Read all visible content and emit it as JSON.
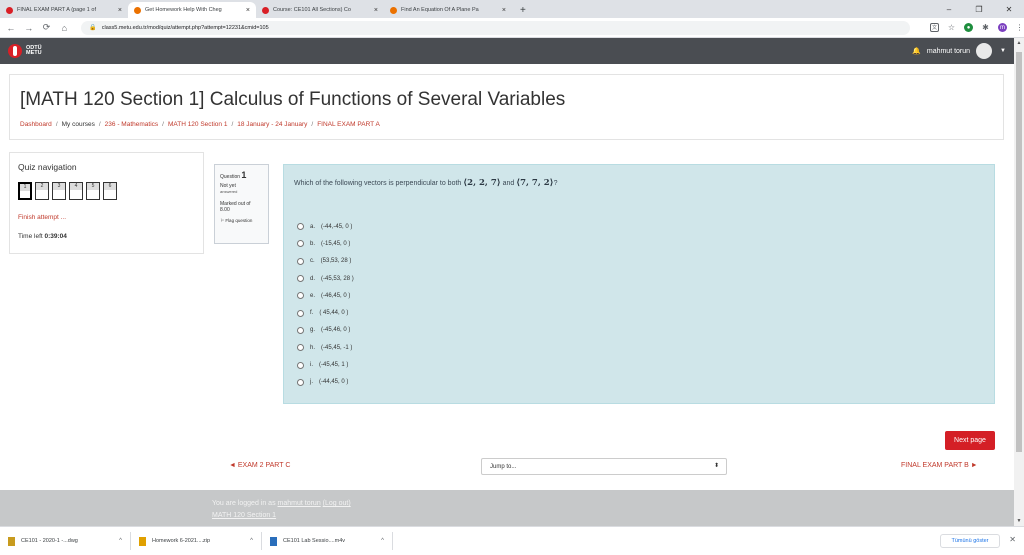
{
  "browser": {
    "tabs": [
      {
        "title": "FINAL EXAM PART A (page 1 of",
        "color": "#d91f26",
        "active": false
      },
      {
        "title": "Get Homework Help With Cheg",
        "color": "#eb7100",
        "active": true
      },
      {
        "title": "Course: CE101 All Sections) Co",
        "color": "#d91f26",
        "active": false
      },
      {
        "title": "Find An Equation Of A Plane Pa",
        "color": "#eb7100",
        "active": false
      }
    ],
    "tab_close": "×",
    "new_tab": "+",
    "window": {
      "minimize": "–",
      "maximize": "❐",
      "close": "✕"
    },
    "url": "class5.metu.edu.tr/mod/quiz/attempt.php?attempt=12231&cmid=105",
    "extensions": {
      "profile_initial": "m"
    }
  },
  "header": {
    "logo_text_line1": "ODTÜ",
    "logo_text_line2": "METU",
    "user_name": "mahmut torun"
  },
  "page": {
    "title": "[MATH 120 Section 1] Calculus of Functions of Several Variables",
    "breadcrumb": [
      "Dashboard",
      "My courses",
      "236 - Mathematics",
      "MATH 120 Section 1",
      "18 January - 24 January",
      "FINAL EXAM PART A"
    ]
  },
  "quiz_nav": {
    "title": "Quiz navigation",
    "buttons": [
      "1",
      "2",
      "3",
      "4",
      "5",
      "6"
    ],
    "finish": "Finish attempt ...",
    "time_label": "Time left",
    "time_value": "0:39:04"
  },
  "question": {
    "label": "Question",
    "number": "1",
    "state_line1": "Not yet",
    "state_line2": "answered",
    "grade_line1": "Marked out of",
    "grade_line2": "8.00",
    "flag": "Flag question",
    "text_before": "Which of the following vectors is perpendicular to both",
    "vec1": "⟨2, 2, 7⟩",
    "text_and": "and",
    "vec2": "⟨7, 7, 2⟩",
    "text_after": "?",
    "answers": [
      {
        "letter": "a.",
        "value": "(-44,-45, 0 )"
      },
      {
        "letter": "b.",
        "value": "(-15,45, 0 )"
      },
      {
        "letter": "c.",
        "value": "(53,53, 28 )"
      },
      {
        "letter": "d.",
        "value": "(-45,53, 28 )"
      },
      {
        "letter": "e.",
        "value": "(-46,45, 0 )"
      },
      {
        "letter": "f.",
        "value": "( 45,44, 0 )"
      },
      {
        "letter": "g.",
        "value": "(-45,46, 0 )"
      },
      {
        "letter": "h.",
        "value": "(-45,45, -1 )"
      },
      {
        "letter": "i.",
        "value": "(-45,45, 1 )"
      },
      {
        "letter": "j.",
        "value": "(-44,45, 0 )"
      }
    ]
  },
  "actions": {
    "next_page": "Next page",
    "prev_activity": "◄ EXAM 2 PART C",
    "jump_to": "Jump to...",
    "next_activity": "FINAL EXAM PART B ►"
  },
  "footer": {
    "logged_in_prefix": "You are logged in as",
    "user_link": "mahmut torun",
    "logout": "(Log out)",
    "course": "MATH 120 Section 1"
  },
  "downloads": {
    "items": [
      {
        "name": "CE101 - 2020-1 -...dwg",
        "color": "#c89b1e"
      },
      {
        "name": "Homework 6-2021....zip",
        "color": "#e0a000"
      },
      {
        "name": "CE101 Lab Sessio....m4v",
        "color": "#2a6ebb"
      }
    ],
    "show_all": "Tümünü göster"
  }
}
